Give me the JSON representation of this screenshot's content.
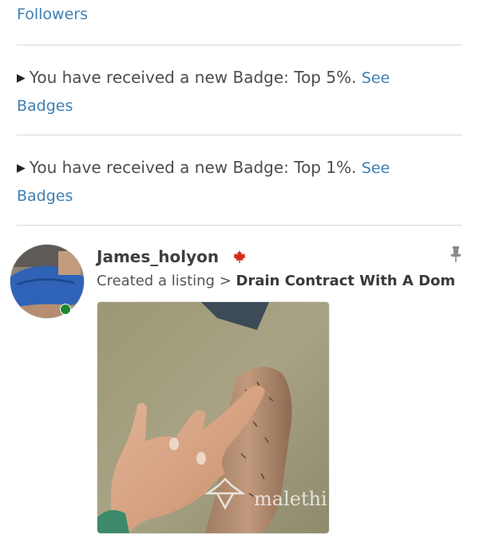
{
  "feed": {
    "top_link": "Followers",
    "notifications": [
      {
        "text": "You have received a new Badge: Top 5%.",
        "link": "See Badges",
        "link_part1": "See",
        "link_part2": "Badges"
      },
      {
        "text": "You have received a new Badge: Top 1%.",
        "link": "See Badges",
        "link_part1": "See",
        "link_part2": "Badges"
      }
    ],
    "post": {
      "username": "James_holyon",
      "country_icon": "canada-maple-leaf-icon",
      "action_text": "Created a listing >",
      "listing_title": "Drain Contract With A Dom",
      "online": true,
      "pin_icon": "pin-icon",
      "watermark": "malethi"
    }
  },
  "colors": {
    "link": "#3f7fb3",
    "online": "#1a8a2a",
    "flag": "#d52b1e",
    "divider": "#d8d8d8"
  }
}
